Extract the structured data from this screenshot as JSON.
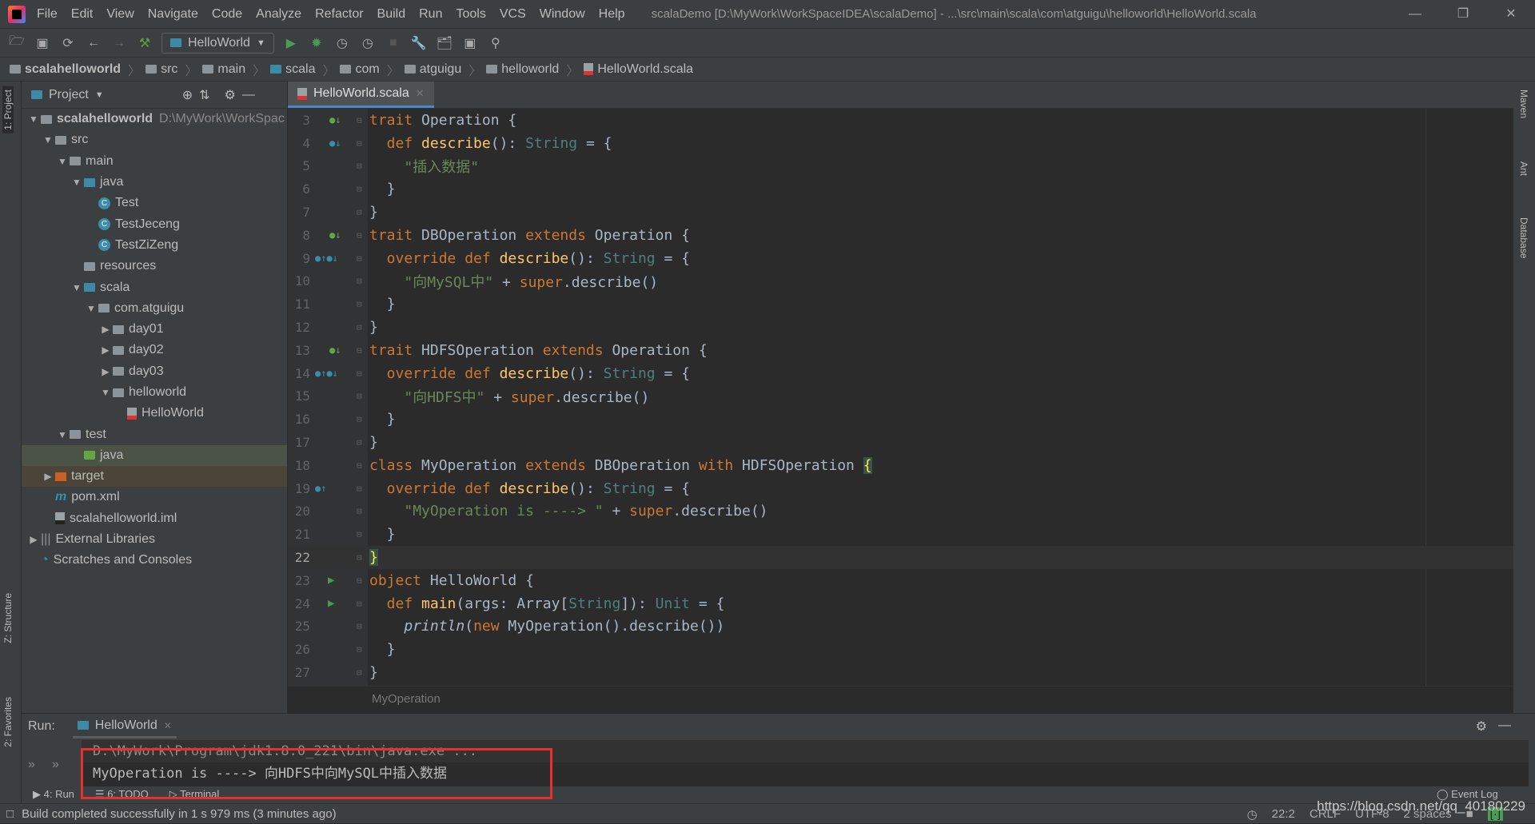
{
  "titlebar": {
    "menus": [
      "File",
      "Edit",
      "View",
      "Navigate",
      "Code",
      "Analyze",
      "Refactor",
      "Build",
      "Run",
      "Tools",
      "VCS",
      "Window",
      "Help"
    ],
    "title": "scalaDemo [D:\\MyWork\\WorkSpaceIDEA\\scalaDemo] - ...\\src\\main\\scala\\com\\atguigu\\helloworld\\HelloWorld.scala"
  },
  "toolbar": {
    "run_config": "HelloWorld"
  },
  "breadcrumb": [
    "scalahelloworld",
    "src",
    "main",
    "scala",
    "com",
    "atguigu",
    "helloworld",
    "HelloWorld.scala"
  ],
  "left_strip": {
    "project": "1: Project",
    "structure": "Z: Structure",
    "favorites": "2: Favorites"
  },
  "right_strip": {
    "maven": "Maven",
    "ant": "Ant",
    "database": "Database"
  },
  "project": {
    "title": "Project",
    "tree": [
      {
        "label": "scalahelloworld",
        "extra": "D:\\MyWork\\WorkSpac",
        "depth": 0,
        "arrow": "down",
        "icon": "module",
        "bold": true
      },
      {
        "label": "src",
        "depth": 1,
        "arrow": "down",
        "icon": "folder"
      },
      {
        "label": "main",
        "depth": 2,
        "arrow": "down",
        "icon": "folder"
      },
      {
        "label": "java",
        "depth": 3,
        "arrow": "down",
        "icon": "folder-blue"
      },
      {
        "label": "Test",
        "depth": 4,
        "icon": "class"
      },
      {
        "label": "TestJeceng",
        "depth": 4,
        "icon": "class"
      },
      {
        "label": "TestZiZeng",
        "depth": 4,
        "icon": "class"
      },
      {
        "label": "resources",
        "depth": 3,
        "icon": "folder"
      },
      {
        "label": "scala",
        "depth": 3,
        "arrow": "down",
        "icon": "folder-blue"
      },
      {
        "label": "com.atguigu",
        "depth": 4,
        "arrow": "down",
        "icon": "package"
      },
      {
        "label": "day01",
        "depth": 5,
        "arrow": "right",
        "icon": "package"
      },
      {
        "label": "day02",
        "depth": 5,
        "arrow": "right",
        "icon": "package"
      },
      {
        "label": "day03",
        "depth": 5,
        "arrow": "right",
        "icon": "package"
      },
      {
        "label": "helloworld",
        "depth": 5,
        "arrow": "down",
        "icon": "package"
      },
      {
        "label": "HelloWorld",
        "depth": 6,
        "icon": "scala"
      },
      {
        "label": "test",
        "depth": 2,
        "arrow": "down",
        "icon": "folder"
      },
      {
        "label": "java",
        "depth": 3,
        "icon": "folder-green",
        "state": "selected"
      },
      {
        "label": "target",
        "depth": 1,
        "arrow": "right",
        "icon": "folder-orange",
        "state": "excluded"
      },
      {
        "label": "pom.xml",
        "depth": 1,
        "icon": "maven"
      },
      {
        "label": "scalahelloworld.iml",
        "depth": 1,
        "icon": "iml"
      },
      {
        "label": "External Libraries",
        "depth": 0,
        "arrow": "right",
        "icon": "libraries"
      },
      {
        "label": "Scratches and Consoles",
        "depth": 0,
        "icon": "scratches"
      }
    ]
  },
  "editor": {
    "tab": "HelloWorld.scala",
    "breadcrumb": "MyOperation",
    "current_line": 22,
    "lines": [
      {
        "n": 3,
        "g": "I",
        "t": [
          [
            "trait ",
            "k"
          ],
          [
            "Operation {",
            "p"
          ]
        ]
      },
      {
        "n": 4,
        "g": "o",
        "t": [
          [
            "  def ",
            "k"
          ],
          [
            "describe",
            "f"
          ],
          [
            "(): ",
            "p"
          ],
          [
            "String",
            "t"
          ],
          [
            " = {",
            "p"
          ]
        ]
      },
      {
        "n": 5,
        "t": [
          [
            "    ",
            "p"
          ],
          [
            "\"插入数据\"",
            "s"
          ]
        ]
      },
      {
        "n": 6,
        "t": [
          [
            "  }",
            "p"
          ]
        ]
      },
      {
        "n": 7,
        "t": [
          [
            "}",
            "p"
          ]
        ]
      },
      {
        "n": 8,
        "g": "I",
        "t": [
          [
            "trait ",
            "k"
          ],
          [
            "DBOperation ",
            "p"
          ],
          [
            "extends ",
            "k"
          ],
          [
            "Operation {",
            "p"
          ]
        ]
      },
      {
        "n": 9,
        "g": "oo",
        "t": [
          [
            "  override def ",
            "k"
          ],
          [
            "describe",
            "f"
          ],
          [
            "(): ",
            "p"
          ],
          [
            "String",
            "t"
          ],
          [
            " = {",
            "p"
          ]
        ]
      },
      {
        "n": 10,
        "t": [
          [
            "    ",
            "p"
          ],
          [
            "\"向MySQL中\"",
            "s"
          ],
          [
            " + ",
            "p"
          ],
          [
            "super",
            "k"
          ],
          [
            ".describe()",
            "p"
          ]
        ]
      },
      {
        "n": 11,
        "t": [
          [
            "  }",
            "p"
          ]
        ]
      },
      {
        "n": 12,
        "t": [
          [
            "}",
            "p"
          ]
        ]
      },
      {
        "n": 13,
        "g": "I",
        "t": [
          [
            "trait ",
            "k"
          ],
          [
            "HDFSOperation ",
            "p"
          ],
          [
            "extends ",
            "k"
          ],
          [
            "Operation {",
            "p"
          ]
        ]
      },
      {
        "n": 14,
        "g": "oo",
        "t": [
          [
            "  override def ",
            "k"
          ],
          [
            "describe",
            "f"
          ],
          [
            "(): ",
            "p"
          ],
          [
            "String",
            "t"
          ],
          [
            " = {",
            "p"
          ]
        ]
      },
      {
        "n": 15,
        "t": [
          [
            "    ",
            "p"
          ],
          [
            "\"向HDFS中\"",
            "s"
          ],
          [
            " + ",
            "p"
          ],
          [
            "super",
            "k"
          ],
          [
            ".describe()",
            "p"
          ]
        ]
      },
      {
        "n": 16,
        "t": [
          [
            "  }",
            "p"
          ]
        ]
      },
      {
        "n": 17,
        "t": [
          [
            "}",
            "p"
          ]
        ]
      },
      {
        "n": 18,
        "t": [
          [
            "class ",
            "k"
          ],
          [
            "MyOperation ",
            "p"
          ],
          [
            "extends ",
            "k"
          ],
          [
            "DBOperation ",
            "p"
          ],
          [
            "with ",
            "k"
          ],
          [
            "HDFSOperation ",
            "p"
          ],
          [
            "{",
            "br"
          ]
        ]
      },
      {
        "n": 19,
        "g": "o",
        "t": [
          [
            "  override def ",
            "k"
          ],
          [
            "describe",
            "f"
          ],
          [
            "(): ",
            "p"
          ],
          [
            "String",
            "t"
          ],
          [
            " = {",
            "p"
          ]
        ]
      },
      {
        "n": 20,
        "t": [
          [
            "    ",
            "p"
          ],
          [
            "\"MyOperation is ----> \"",
            "s"
          ],
          [
            " + ",
            "p"
          ],
          [
            "super",
            "k"
          ],
          [
            ".describe()",
            "p"
          ]
        ]
      },
      {
        "n": 21,
        "t": [
          [
            "  }",
            "p"
          ]
        ]
      },
      {
        "n": 22,
        "t": [
          [
            "}",
            "br"
          ]
        ]
      },
      {
        "n": 23,
        "g": "run",
        "t": [
          [
            "object ",
            "k"
          ],
          [
            "HelloWorld {",
            "p"
          ]
        ]
      },
      {
        "n": 24,
        "g": "run",
        "t": [
          [
            "  def ",
            "k"
          ],
          [
            "main",
            "f"
          ],
          [
            "(args: Array[",
            "p"
          ],
          [
            "String",
            "t"
          ],
          [
            "]): ",
            "p"
          ],
          [
            "Unit",
            "t"
          ],
          [
            " = {",
            "p"
          ]
        ]
      },
      {
        "n": 25,
        "t": [
          [
            "    ",
            "p"
          ],
          [
            "println",
            "i"
          ],
          [
            "(",
            "p"
          ],
          [
            "new ",
            "k"
          ],
          [
            "MyOperation().describe())",
            "p"
          ]
        ]
      },
      {
        "n": 26,
        "t": [
          [
            "  }",
            "p"
          ]
        ]
      },
      {
        "n": 27,
        "t": [
          [
            "}",
            "p"
          ]
        ]
      }
    ]
  },
  "run": {
    "label": "Run:",
    "tab": "HelloWorld",
    "console": [
      "D:\\MyWork\\Program\\jdk1.8.0_221\\bin\\java.exe ...",
      "MyOperation is ----> 向HDFS中向MySQL中插入数据"
    ]
  },
  "bottom_tabs": [
    "4: Run",
    "6: TODO",
    "Terminal"
  ],
  "event_log": "Event Log",
  "status": {
    "message": "Build completed successfully in 1 s 979 ms (3 minutes ago)",
    "position": "22:2",
    "line_sep": "CRLF",
    "encoding": "UTF-8",
    "indent": "2 spaces"
  },
  "watermark": "https://blog.csdn.net/qq_40180229",
  "colors": {
    "keyword": "#cc7832",
    "function": "#ffc66d",
    "string": "#6a8759",
    "type": "#4e807d",
    "highlight_box": "#e8312f"
  }
}
